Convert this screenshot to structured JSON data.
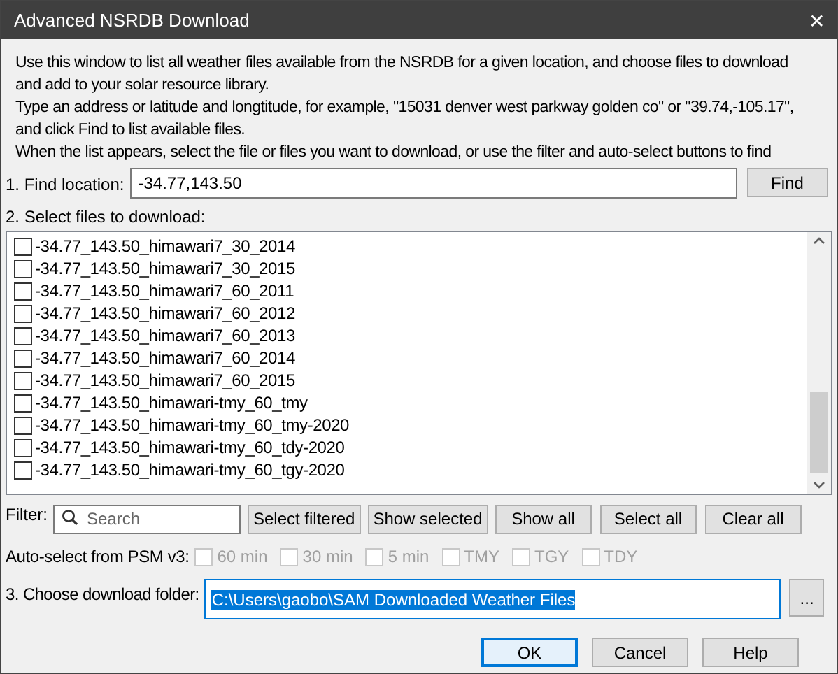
{
  "window": {
    "title": "Advanced NSRDB Download",
    "close": "✕"
  },
  "intro": [
    "Use this window to list all weather files available from the NSRDB for a given location, and choose files to download",
    "and add to your solar resource library.",
    "Type an address or latitude and longtitude, for example, \"15031 denver west parkway golden co\" or \"39.74,-105.17\",",
    "and click Find to list available files.",
    "When the list appears, select the file or files you want to download, or use the filter and auto-select buttons to find"
  ],
  "find": {
    "label": "1. Find location:",
    "value": "-34.77,143.50",
    "button": "Find"
  },
  "files": {
    "label": "2. Select files to download:",
    "items": [
      {
        "name": "-34.77_143.50_himawari7_30_2014",
        "checked": false
      },
      {
        "name": "-34.77_143.50_himawari7_30_2015",
        "checked": false
      },
      {
        "name": "-34.77_143.50_himawari7_60_2011",
        "checked": false
      },
      {
        "name": "-34.77_143.50_himawari7_60_2012",
        "checked": false
      },
      {
        "name": "-34.77_143.50_himawari7_60_2013",
        "checked": false
      },
      {
        "name": "-34.77_143.50_himawari7_60_2014",
        "checked": false
      },
      {
        "name": "-34.77_143.50_himawari7_60_2015",
        "checked": false
      },
      {
        "name": "-34.77_143.50_himawari-tmy_60_tmy",
        "checked": false
      },
      {
        "name": "-34.77_143.50_himawari-tmy_60_tmy-2020",
        "checked": false
      },
      {
        "name": "-34.77_143.50_himawari-tmy_60_tdy-2020",
        "checked": false
      },
      {
        "name": "-34.77_143.50_himawari-tmy_60_tgy-2020",
        "checked": false
      }
    ]
  },
  "filter": {
    "label": "Filter:",
    "placeholder": "Search",
    "buttons": [
      "Select filtered",
      "Show selected",
      "Show all",
      "Select all",
      "Clear all"
    ]
  },
  "auto_select": {
    "label": "Auto-select from PSM v3:",
    "options": [
      {
        "label": "60 min",
        "checked": false,
        "disabled": true
      },
      {
        "label": "30 min",
        "checked": false,
        "disabled": true
      },
      {
        "label": "5 min",
        "checked": false,
        "disabled": true
      },
      {
        "label": "TMY",
        "checked": false,
        "disabled": true
      },
      {
        "label": "TGY",
        "checked": false,
        "disabled": true
      },
      {
        "label": "TDY",
        "checked": false,
        "disabled": true
      }
    ]
  },
  "folder": {
    "label": "3. Choose download folder:",
    "value": "C:\\Users\\gaobo\\SAM Downloaded Weather Files",
    "browse": "..."
  },
  "buttons": [
    {
      "label": "OK",
      "selected": true
    },
    {
      "label": "Cancel",
      "selected": false
    },
    {
      "label": "Help",
      "selected": false
    }
  ]
}
